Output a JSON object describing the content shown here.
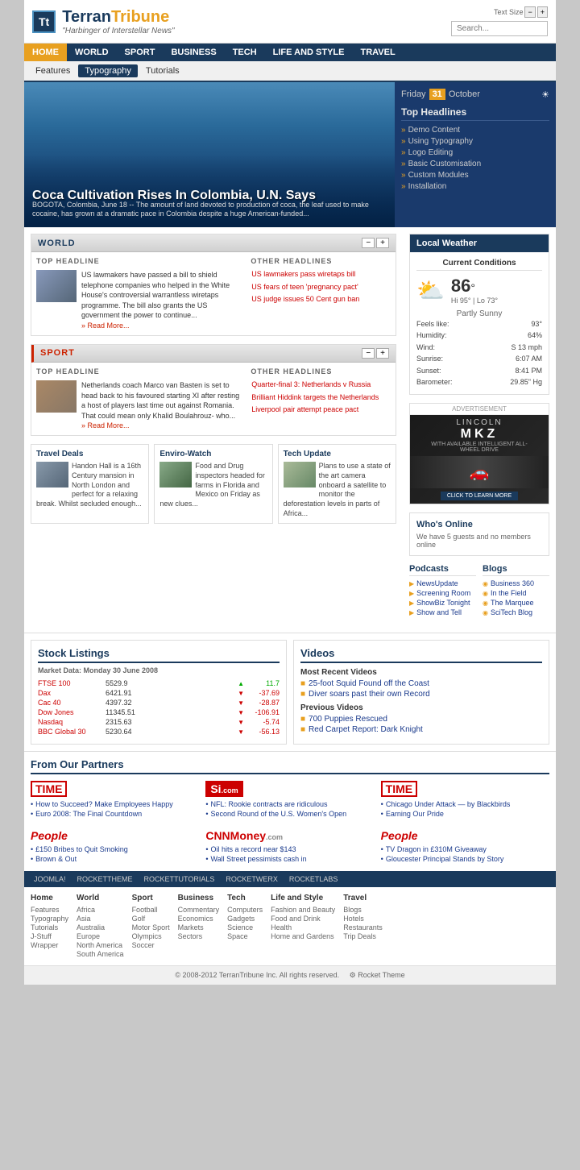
{
  "header": {
    "logo_initials": "Tt",
    "site_name_1": "Terran",
    "site_name_2": "Tribune",
    "tagline": "\"Harbinger of Interstellar News\"",
    "text_size_label": "Text Size",
    "search_placeholder": "Search..."
  },
  "nav": {
    "items": [
      {
        "label": "HOME",
        "active": true
      },
      {
        "label": "WORLD",
        "active": false
      },
      {
        "label": "SPORT",
        "active": false
      },
      {
        "label": "BUSINESS",
        "active": false
      },
      {
        "label": "TECH",
        "active": false
      },
      {
        "label": "LIFE AND STYLE",
        "active": false
      },
      {
        "label": "TRAVEL",
        "active": false
      }
    ]
  },
  "sub_nav": {
    "items": [
      {
        "label": "Features",
        "active": false
      },
      {
        "label": "Typography",
        "active": true
      },
      {
        "label": "Tutorials",
        "active": false
      }
    ]
  },
  "hero": {
    "date_day": "Friday",
    "date_num": "31",
    "date_month": "October",
    "title": "Coca Cultivation Rises In Colombia, U.N. Says",
    "subtitle": "BOGOTA, Colombia, June 18 -- The amount of land devoted to production of coca, the leaf used to make cocaine, has grown at a dramatic pace in Colombia despite a huge American-funded...",
    "top_headlines_title": "Top Headlines",
    "headlines": [
      "Demo Content",
      "Using Typography",
      "Logo Editing",
      "Basic Customisation",
      "Custom Modules",
      "Installation"
    ]
  },
  "world_section": {
    "title": "WORLD",
    "top_headline_label": "TOP HEADLINE",
    "other_headlines_label": "OTHER HEADLINES",
    "main_text": "US lawmakers have passed a bill to shield telephone companies who helped in the White House's controversial warrantless wiretaps programme. The bill also grants the US government the power to continue...",
    "read_more": "Read More...",
    "other_links": [
      "US lawmakers pass wiretaps bill",
      "US fears of teen 'pregnancy pact'",
      "US judge issues 50 Cent gun ban"
    ]
  },
  "sport_section": {
    "title": "SPORT",
    "top_headline_label": "TOP HEADLINE",
    "other_headlines_label": "OTHER HEADLINES",
    "main_text": "Netherlands coach Marco van Basten is set to head back to his favoured starting XI after resting a host of players last time out against Romania. That could mean only Khalid Boulahrouz- who...",
    "read_more": "Read More...",
    "other_links": [
      "Quarter-final 3: Netherlands v Russia",
      "Brilliant Hiddink targets the Netherlands",
      "Liverpool pair attempt peace pact"
    ]
  },
  "mini_boxes": [
    {
      "title": "Travel Deals",
      "text": "Handon Hall is a 16th Century mansion in North London and perfect for a relaxing break. Whilst secluded enough..."
    },
    {
      "title": "Enviro-Watch",
      "text": "Food and Drug inspectors headed for farms in Florida and Mexico on Friday as new clues..."
    },
    {
      "title": "Tech Update",
      "text": "Plans to use a state of the art camera onboard a satellite to monitor the deforestation levels in parts of Africa..."
    }
  ],
  "weather": {
    "section_title": "Local Weather",
    "conditions_title": "Current Conditions",
    "temp": "86",
    "unit": "°",
    "hi": "Hi 95°",
    "lo": "Lo 73°",
    "condition": "Partly Sunny",
    "feels_like": "93°",
    "humidity": "64%",
    "wind": "S 13 mph",
    "sunrise": "6:07 AM",
    "sunset": "8:41 PM",
    "barometer": "29.85\" Hg"
  },
  "ad": {
    "label": "ADVERTISEMENT",
    "car_name": "LINCOLN",
    "model": "MKZ",
    "tagline": "WITH AVAILABLE INTELLIGENT ALL-WHEEL DRIVE",
    "cta": "CLICK TO LEARN MORE",
    "brand": "LINCOLN"
  },
  "whos_online": {
    "title": "Who's Online",
    "text": "We have 5 guests and no members online"
  },
  "podcasts": {
    "title": "Podcasts",
    "items": [
      "NewsUpdate",
      "Screening Room",
      "ShowBiz Tonight",
      "Show and Tell"
    ]
  },
  "blogs": {
    "title": "Blogs",
    "items": [
      "Business 360",
      "In the Field",
      "The Marquee",
      "SciTech Blog"
    ]
  },
  "stocks": {
    "title": "Stock Listings",
    "market_date": "Market Data: Monday 30 June 2008",
    "rows": [
      {
        "name": "FTSE 100",
        "val": "5529.9",
        "change": "11.7",
        "up": true
      },
      {
        "name": "Dax",
        "val": "6421.91",
        "change": "-37.69",
        "up": false
      },
      {
        "name": "Cac 40",
        "val": "4397.32",
        "change": "-28.87",
        "up": false
      },
      {
        "name": "Dow Jones",
        "val": "11345.51",
        "change": "-106.91",
        "up": false
      },
      {
        "name": "Nasdaq",
        "val": "2315.63",
        "change": "-5.74",
        "up": false
      },
      {
        "name": "BBC Global 30",
        "val": "5230.64",
        "change": "-56.13",
        "up": false
      }
    ]
  },
  "videos": {
    "title": "Videos",
    "most_recent_title": "Most Recent Videos",
    "most_recent": [
      "25-foot Squid Found off the Coast",
      "Diver soars past their own Record"
    ],
    "previous_title": "Previous Videos",
    "previous": [
      "700 Puppies Rescued",
      "Red Carpet Report: Dark Knight"
    ]
  },
  "partners": {
    "title": "From Our Partners",
    "cols": [
      {
        "logo": "TIME",
        "logo_type": "time",
        "links": [
          "How to Succeed? Make Employees Happy",
          "Euro 2008: The Final Countdown"
        ]
      },
      {
        "logo": "Si.com",
        "logo_type": "si",
        "links": [
          "NFL: Rookie contracts are ridiculous",
          "Second Round of the U.S. Women's Open"
        ]
      },
      {
        "logo": "CNNMoney.com",
        "logo_type": "cnn",
        "links": [
          "Oil hits a record near $143",
          "Wall Street pessimists cash in"
        ]
      },
      {
        "logo": "TIME",
        "logo_type": "time",
        "links": [
          "Chicago Under Attack — by Blackbirds",
          "Earning Our Pride"
        ]
      },
      {
        "logo": "People",
        "logo_type": "people",
        "links": [
          "TV Dragon in £310M Giveaway",
          "Gloucester Principal Stands by Story"
        ]
      }
    ]
  },
  "footer_nav": {
    "items": [
      "JOOMLA!",
      "ROCKETTHEME",
      "ROCKETTUTORIALS",
      "ROCKETWERX",
      "ROCKETLABS"
    ]
  },
  "footer_links": {
    "cols": [
      {
        "title": "Home",
        "links": [
          "Features",
          "Typography",
          "Tutorials",
          "J-Stuff",
          "Wrapper"
        ]
      },
      {
        "title": "World",
        "links": [
          "Africa",
          "Asia",
          "Australia",
          "Europe",
          "North America",
          "South America"
        ]
      },
      {
        "title": "Sport",
        "links": [
          "Football",
          "Golf",
          "Motor Sport",
          "Olympics",
          "Soccer"
        ]
      },
      {
        "title": "Business",
        "links": [
          "Commentary",
          "Economics",
          "Markets",
          "Sectors"
        ]
      },
      {
        "title": "Tech",
        "links": [
          "Computers",
          "Gadgets",
          "Science",
          "Space"
        ]
      },
      {
        "title": "Life and Style",
        "links": [
          "Fashion and Beauty",
          "Food and Drink",
          "Health",
          "Home and Gardens"
        ]
      },
      {
        "title": "Travel",
        "links": [
          "Blogs",
          "Hotels",
          "Restaurants",
          "Trip Deals"
        ]
      }
    ]
  },
  "footer_bottom": "© 2008-2012 TerranTribune Inc. All rights reserved."
}
